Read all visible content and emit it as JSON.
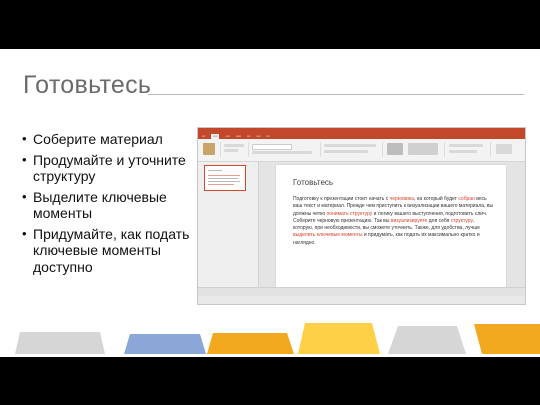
{
  "slide": {
    "title": "Готовьтесь",
    "bullets": [
      "Соберите материал",
      "Продумайте и уточните структуру",
      "Выделите ключевые моменты",
      "Придумайте, как подать ключевые моменты доступно"
    ]
  },
  "screenshot": {
    "slide_title": "Готовьтесь",
    "text_parts": [
      {
        "t": "Подготовку к презентации стоит начать с ",
        "hl": false
      },
      {
        "t": "черновика",
        "hl": true
      },
      {
        "t": ", на который будет ",
        "hl": false
      },
      {
        "t": "собран",
        "hl": true
      },
      {
        "t": " весь ваш текст и материал.  Прежде чем приступить к визуализации вашего материала, вы должны четко ",
        "hl": false
      },
      {
        "t": "понимать структуру",
        "hl": true
      },
      {
        "t": " и логику вашего выступления, подготовить слич. Соберите черновую презентацию. Так вы ",
        "hl": false
      },
      {
        "t": "визуализируете",
        "hl": true
      },
      {
        "t": " для себя ",
        "hl": false
      },
      {
        "t": "структуру",
        "hl": true
      },
      {
        "t": ", которую, при необходимости, вы сможете уточнить. Также, для удобства, лучше ",
        "hl": false
      },
      {
        "t": "выделить ключевые моменты",
        "hl": true
      },
      {
        "t": " и придумать, как подать их максимально кратко и наглядно.",
        "hl": false
      }
    ]
  },
  "colors": {
    "accent_red": "#c2472b",
    "deco_orange": "#f2a91f",
    "deco_yellow": "#fdd047",
    "deco_blue": "#8aa7d8",
    "deco_grey": "#d6d6d6"
  }
}
